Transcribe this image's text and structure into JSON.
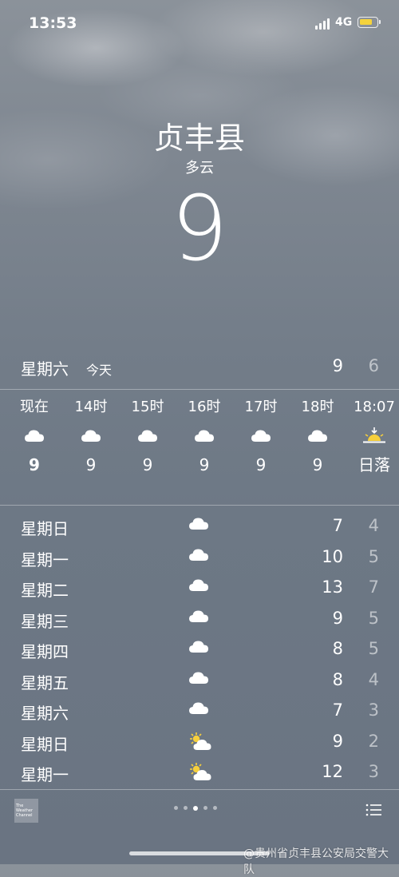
{
  "status_bar": {
    "time": "13:53",
    "network": "4G",
    "battery_color": "#f5d33c"
  },
  "location": {
    "city": "贞丰县",
    "condition": "多云",
    "temperature": "9"
  },
  "today": {
    "day": "星期六",
    "label": "今天",
    "high": "9",
    "low": "6"
  },
  "hourly": [
    {
      "label": "现在",
      "icon": "cloud-icon",
      "temp": "9"
    },
    {
      "label": "14时",
      "icon": "cloud-icon",
      "temp": "9"
    },
    {
      "label": "15时",
      "icon": "cloud-icon",
      "temp": "9"
    },
    {
      "label": "16时",
      "icon": "cloud-icon",
      "temp": "9"
    },
    {
      "label": "17时",
      "icon": "cloud-icon",
      "temp": "9"
    },
    {
      "label": "18时",
      "icon": "cloud-icon",
      "temp": "9"
    },
    {
      "label": "18:07",
      "icon": "sunset-icon",
      "temp": "日落"
    }
  ],
  "daily": [
    {
      "day": "星期日",
      "icon": "cloud-icon",
      "high": "7",
      "low": "4"
    },
    {
      "day": "星期一",
      "icon": "cloud-icon",
      "high": "10",
      "low": "5"
    },
    {
      "day": "星期二",
      "icon": "cloud-icon",
      "high": "13",
      "low": "7"
    },
    {
      "day": "星期三",
      "icon": "cloud-icon",
      "high": "9",
      "low": "5"
    },
    {
      "day": "星期四",
      "icon": "cloud-icon",
      "high": "8",
      "low": "5"
    },
    {
      "day": "星期五",
      "icon": "cloud-icon",
      "high": "8",
      "low": "4"
    },
    {
      "day": "星期六",
      "icon": "cloud-icon",
      "high": "7",
      "low": "3"
    },
    {
      "day": "星期日",
      "icon": "partly-sunny-icon",
      "high": "9",
      "low": "2"
    },
    {
      "day": "星期一",
      "icon": "partly-sunny-icon",
      "high": "12",
      "low": "3"
    }
  ],
  "footer": {
    "logo_text": "The Weather Channel",
    "pages": 5,
    "active_page": 2
  },
  "watermark": "@贵州省贞丰县公安局交警大队"
}
